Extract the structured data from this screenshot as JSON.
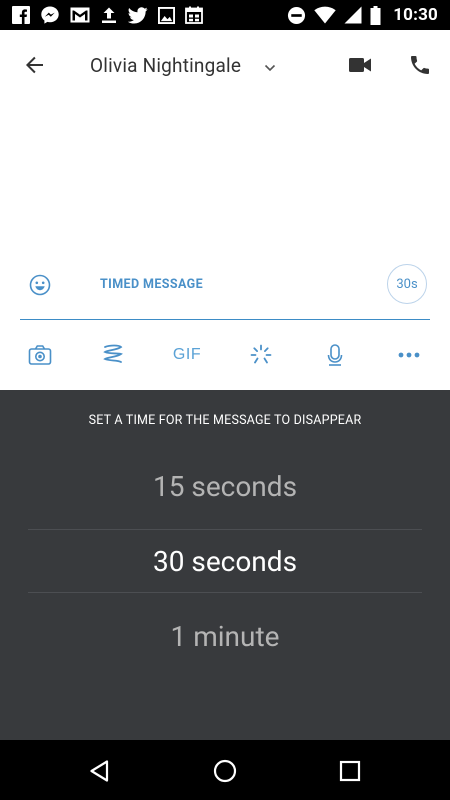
{
  "status_bar": {
    "time": "10:30",
    "icons": [
      "facebook-icon",
      "messenger-icon",
      "gmail-icon",
      "upload-icon",
      "twitter-icon",
      "image-icon",
      "calendar-icon",
      "do-not-disturb-icon",
      "wifi-icon",
      "signal-icon",
      "battery-icon"
    ]
  },
  "header": {
    "contact_name": "Olivia Nightingale",
    "icons": [
      "back-arrow-icon",
      "chevron-down-icon",
      "video-call-icon",
      "phone-icon"
    ]
  },
  "composer": {
    "label": "TIMED MESSAGE",
    "timer_value": "30s",
    "toolbar": {
      "gif_label": "GIF",
      "icons": [
        "camera-icon",
        "scribble-icon",
        "gif-icon",
        "sparkle-icon",
        "microphone-icon",
        "more-icon"
      ]
    }
  },
  "time_picker": {
    "title": "SET A TIME FOR THE MESSAGE TO DISAPPEAR",
    "options": [
      "15 seconds",
      "30 seconds",
      "1 minute"
    ],
    "selected_option": "30 seconds"
  },
  "colors": {
    "accent": "#4a90c8",
    "panel_background": "#383a3d",
    "status_bar": "#000000"
  },
  "navigation_bar": {
    "icons": [
      "nav-back-icon",
      "nav-home-icon",
      "nav-recents-icon"
    ]
  }
}
